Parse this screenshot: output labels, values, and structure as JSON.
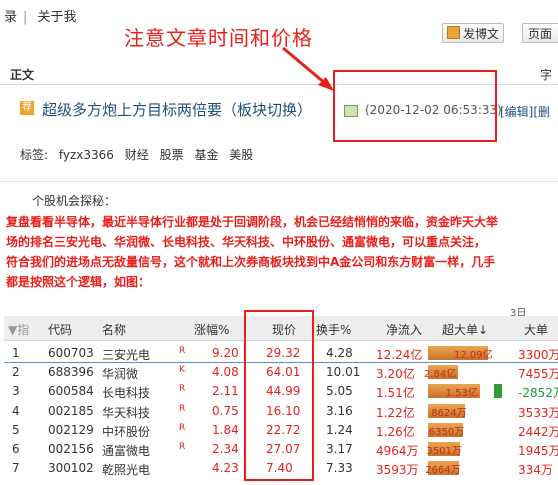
{
  "topnav": {
    "item1": "录",
    "sep": "|",
    "item2": "关于我"
  },
  "annotation": "注意文章时间和价格",
  "buttons": {
    "blog": "发博文",
    "page": "页面"
  },
  "header": {
    "left": "正文",
    "right": "字"
  },
  "article": {
    "badge": "荐",
    "title": "超级多方炮上方目标两倍要（板块切换）",
    "time": "(2020-12-02 06:53:33)",
    "edit": "[编辑][删"
  },
  "tags": {
    "label": "标签:",
    "items": [
      "fyzx3366",
      "财经",
      "股票",
      "基金",
      "美股"
    ]
  },
  "intro": "个股机会探秘：",
  "paragraph": [
    "复盘看看半导体，最近半导体行业都是处于回调阶段，机会已经结悄悄的来临，资金昨天大举",
    "场的排名三安光电、华润微、长电科技、华天科技、中环股份、通富微电，可以重点关注，",
    "符合我们的进场点无敌量信号，这个就和上次券商板块找到中A金公司和东方财富一样，几手",
    "都是按照这个逻辑，如图："
  ],
  "table": {
    "mini_label": "3日",
    "headers": [
      "▼指",
      "代码",
      "名称",
      "涨幅%",
      "现价",
      "换手%",
      "净流入",
      "超大单↓",
      "大单"
    ],
    "rows": [
      {
        "idx": "1",
        "code": "600703",
        "name": "三安光电",
        "flag": "R",
        "chg": "9.20",
        "price": "29.32",
        "turn": "4.28",
        "net": "12.24亿",
        "super": "12.09亿",
        "super_v": 1.0,
        "big": "3300万"
      },
      {
        "idx": "2",
        "code": "688396",
        "name": "华润微",
        "flag": "K",
        "chg": "4.08",
        "price": "64.01",
        "turn": "10.01",
        "net": "3.20亿",
        "super": "2.84亿",
        "super_v": 0.5,
        "big": "7455万"
      },
      {
        "idx": "3",
        "code": "600584",
        "name": "长电科技",
        "flag": "R",
        "chg": "2.11",
        "price": "44.99",
        "turn": "5.05",
        "net": "1.51亿",
        "super": "1.53亿",
        "super_v": 0.86,
        "big": "-2852万"
      },
      {
        "idx": "4",
        "code": "002185",
        "name": "华天科技",
        "flag": "R",
        "chg": "0.75",
        "price": "16.10",
        "turn": "3.16",
        "net": "1.22亿",
        "super": "8624万",
        "super_v": 0.62,
        "big": "3533万"
      },
      {
        "idx": "5",
        "code": "002129",
        "name": "中环股份",
        "flag": "R",
        "chg": "1.84",
        "price": "22.72",
        "turn": "1.24",
        "net": "1.26亿",
        "super": "6350万",
        "super_v": 0.58,
        "big": "2442万"
      },
      {
        "idx": "6",
        "code": "002156",
        "name": "通富微电",
        "flag": "R",
        "chg": "2.34",
        "price": "27.07",
        "turn": "3.17",
        "net": "4964万",
        "super": "3501万",
        "super_v": 0.54,
        "big": "1945万"
      },
      {
        "idx": "7",
        "code": "300102",
        "name": "乾照光电",
        "flag": "",
        "chg": "4.23",
        "price": "7.40",
        "turn": "7.33",
        "net": "3593万",
        "super": "2664万",
        "super_v": 0.52,
        "big": "334万"
      }
    ]
  },
  "colors": {
    "accent_red": "#e8201c",
    "link_blue": "#24507d",
    "bar_orange": "#d9893a"
  }
}
